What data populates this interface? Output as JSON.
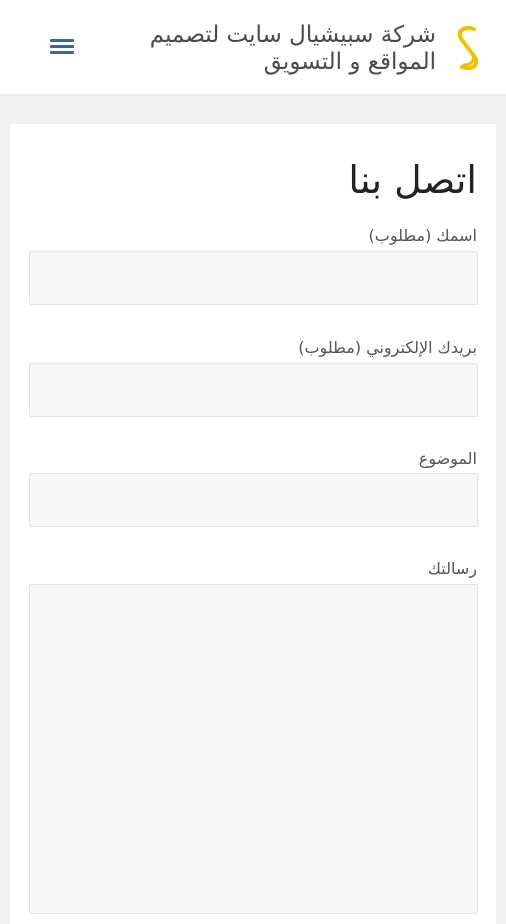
{
  "header": {
    "site_title": "شركة سبيشيال سايت لتصميم المواقع و التسويق",
    "logo_icon": "gold-s-logo-icon",
    "menu_icon": "hamburger-menu-icon",
    "accent_color": "#2d6ba8",
    "logo_color": "#f2c200"
  },
  "contact_form": {
    "title": "اتصل بنا",
    "name_label": "اسمك (مطلوب)",
    "name_value": "",
    "email_label": "بريدك الإلكتروني (مطلوب)",
    "email_value": "",
    "subject_label": "الموضوع",
    "subject_value": "",
    "message_label": "رسالتك",
    "message_value": ""
  }
}
